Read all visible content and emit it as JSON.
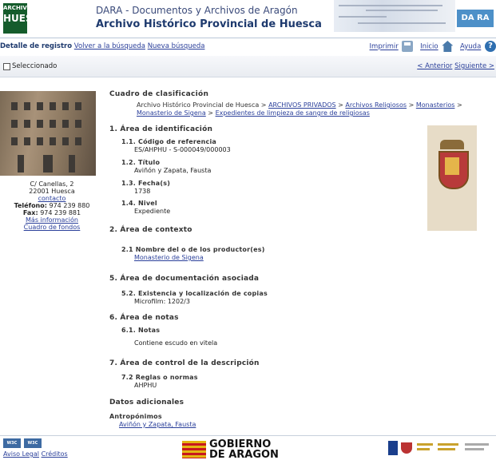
{
  "header": {
    "logo_lines": [
      "ARCHIVO",
      "HISTÓRICO",
      "HUESCA"
    ],
    "title": "DARA - Documentos y Archivos de Aragón",
    "subtitle": "Archivo Histórico Provincial de Huesca",
    "badge": "DA RA"
  },
  "nav": {
    "detail_label": "Detalle de registro",
    "back_link": "Volver a la búsqueda",
    "new_search_link": "Nueva búsqueda",
    "print_label": "Imprimir",
    "home_label": "Inicio",
    "help_label": "Ayuda"
  },
  "toolbar": {
    "selected_label": "Seleccionado",
    "prev_label": "< Anterior",
    "next_label": "Siguiente >"
  },
  "left_panel": {
    "address_line1": "C/ Canellas, 2",
    "address_line2": "22001 Huesca",
    "contact_link": "contacto",
    "phone_label": "Teléfono:",
    "phone_value": "974 239 880",
    "fax_label": "Fax:",
    "fax_value": "974 239 881",
    "more_info_link": "Más información",
    "fonds_link": "Cuadro de fondos"
  },
  "main": {
    "classification_title": "Cuadro de clasificación",
    "breadcrumb": {
      "root": "Archivo Histórico Provincial de Huesca",
      "sep": " > ",
      "items": [
        "ARCHIVOS PRIVADOS",
        "Archivos Religiosos",
        "Monasterios",
        "Monasterio de Sigena",
        "Expedientes de limpieza de sangre de religiosas"
      ]
    },
    "identification": {
      "heading": "1. Área de identificación",
      "ref_label": "1.1. Código de referencia",
      "ref_value": "ES/AHPHU - S-000049/000003",
      "title_label": "1.2. Título",
      "title_value": "Aviñón y Zapata, Fausta",
      "dates_label": "1.3. Fecha(s)",
      "dates_value": "1738",
      "level_label": "1.4. Nivel",
      "level_value": "Expediente"
    },
    "context": {
      "heading": "2. Área de contexto",
      "producer_label": "2.1 Nombre del o de los productor(es)",
      "producer_value": "Monasterio de Sigena"
    },
    "associated": {
      "heading": "5. Área de documentación asociada",
      "copies_label": "5.2. Existencia y localización de copias",
      "copies_value": "Microfilm: 1202/3"
    },
    "notes": {
      "heading": "6. Área de notas",
      "notes_label": "6.1. Notas",
      "notes_value": "Contiene escudo en vitela"
    },
    "control": {
      "heading": "7. Área de control de la descripción",
      "rules_label": "7.2 Reglas o normas",
      "rules_value": "AHPHU"
    },
    "additional": {
      "heading": "Datos adicionales",
      "anthroponyms_label": "Antropónimos",
      "anthroponyms_value": "Aviñón y Zapata, Fausta"
    }
  },
  "footer": {
    "w3c_badges": [
      "W3C WAI-AA",
      "W3C XHTML"
    ],
    "legal_link": "Aviso Legal",
    "credits_link": "Créditos",
    "gov_line1": "GOBIERNO",
    "gov_line2": "DE ARAGON"
  }
}
